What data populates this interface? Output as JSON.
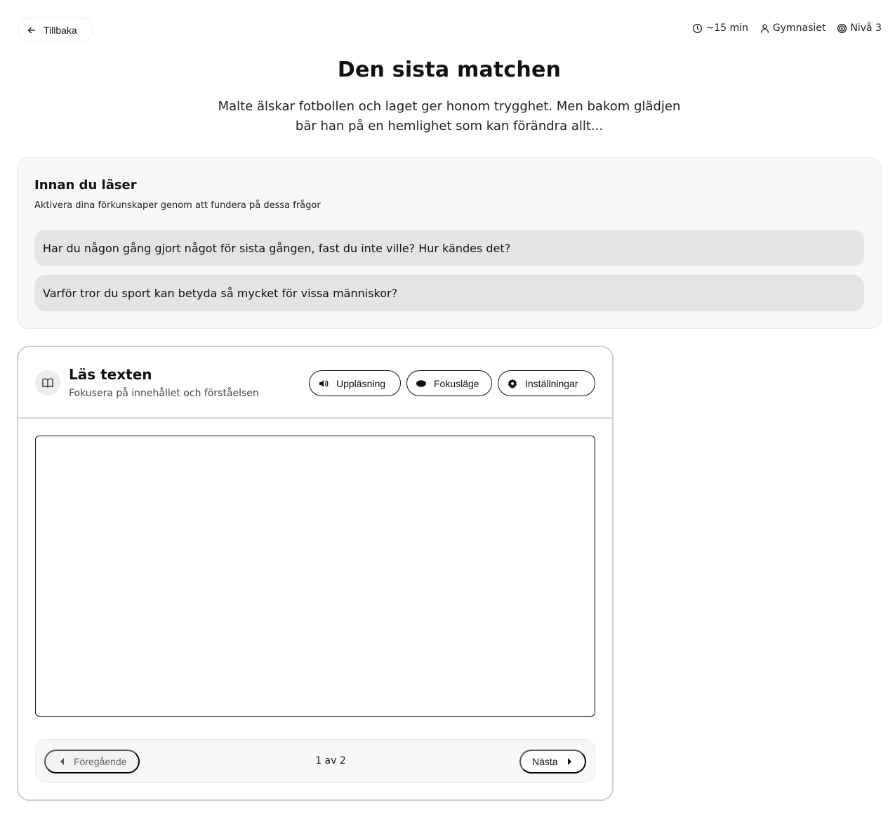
{
  "nav": {
    "back_label": "Tillbaka"
  },
  "meta": {
    "time": "~15 min",
    "audience": "Gymnasiet",
    "level": "Nivå 3"
  },
  "header": {
    "title": "Den sista matchen",
    "subtitle": "Malte älskar fotbollen och laget ger honom trygghet. Men bakom glädjen bär han på en hemlighet som kan förändra allt..."
  },
  "prereading": {
    "title": "Innan du läser",
    "description": "Aktivera dina förkunskaper genom att fundera på dessa frågor",
    "questions": [
      "Har du någon gång gjort något för sista gången, fast du inte ville? Hur kändes det?",
      "Varför tror du sport kan betyda så mycket för vissa människor?"
    ]
  },
  "reader": {
    "title": "Läs texten",
    "subtitle": "Fokusera på innehållet och förståelsen",
    "tools": {
      "read_aloud": "Uppläsning",
      "focus_mode": "Fokusläge",
      "settings": "Inställningar"
    },
    "pagination": {
      "prev_label": "Föregående",
      "indicator": "1 av 2",
      "next_label": "Nästa"
    }
  }
}
